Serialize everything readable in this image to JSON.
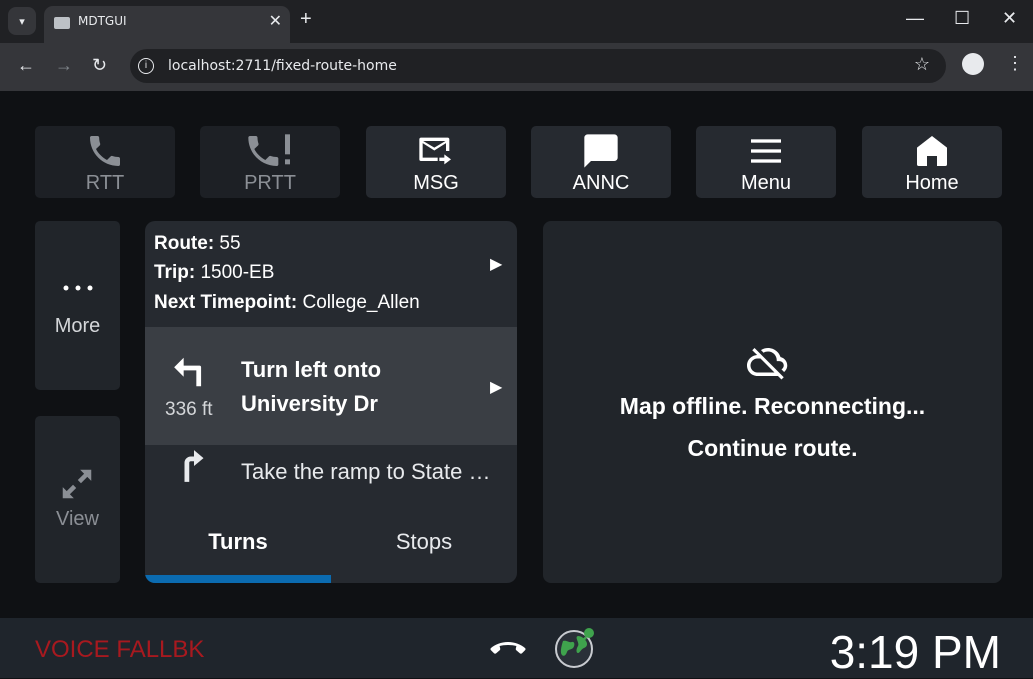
{
  "browser": {
    "tab_title": "MDTGUI",
    "tab_close": "✕",
    "new_tab": "+",
    "url": "localhost:2711/fixed-route-home",
    "controls": {
      "minimize": "—",
      "maximize": "☐",
      "close": "✕"
    }
  },
  "top_buttons": [
    {
      "label": "RTT",
      "icon": "phone-icon"
    },
    {
      "label": "PRTT",
      "icon": "phone-priority-icon"
    },
    {
      "label": "MSG",
      "icon": "mail-forward-icon"
    },
    {
      "label": "ANNC",
      "icon": "chat-bubble-icon"
    },
    {
      "label": "Menu",
      "icon": "hamburger-icon"
    },
    {
      "label": "Home",
      "icon": "home-icon"
    }
  ],
  "side_buttons": {
    "more": {
      "label": "More",
      "icon": "more-dots-icon"
    },
    "view": {
      "label": "View",
      "icon": "expand-arrows-icon"
    }
  },
  "trip": {
    "route_label": "Route:",
    "route_value": " 55",
    "trip_label": "Trip:",
    "trip_value": " 1500-EB",
    "timepoint_label": "Next Timepoint:",
    "timepoint_value": " College_Allen"
  },
  "navigation": {
    "current_line1": "Turn left onto",
    "current_line2": "University Dr",
    "current_distance": "336 ft",
    "next_instruction": "Take the ramp to State Route",
    "tabs": [
      "Turns",
      "Stops"
    ],
    "active_tab": "Turns"
  },
  "map": {
    "status_line1": "Map offline. Reconnecting...",
    "status_line2": "Continue route.",
    "icon": "cloud-off-icon"
  },
  "footer": {
    "voice_status": "VOICE FALLBK",
    "clock": "3:19 PM"
  },
  "colors": {
    "accent": "#0b6bb0",
    "voice_status": "#a8191f",
    "gps_icon": "#3fa34d"
  }
}
